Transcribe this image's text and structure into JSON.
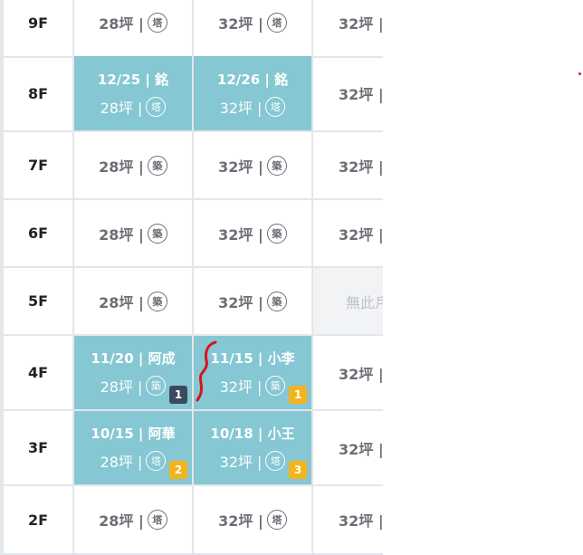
{
  "colors": {
    "booked_bg": "#85c7d3",
    "border": "#e3e6ea",
    "badge_dark": "#3c4a5e",
    "badge_yellow": "#f5b31c"
  },
  "rows": [
    {
      "floor": "9F",
      "units": [
        {
          "size": "28坪 |",
          "mark": "塔"
        },
        {
          "size": "32坪 |",
          "mark": "塔"
        },
        {
          "size": "32坪 |",
          "mark": ""
        }
      ]
    },
    {
      "floor": "8F",
      "units": [
        {
          "booking": "12/25 | 銘",
          "size": "28坪 |",
          "mark": "塔"
        },
        {
          "booking": "12/26 | 銘",
          "size": "32坪 |",
          "mark": "塔"
        },
        {
          "size": "32坪 |",
          "mark": ""
        }
      ]
    },
    {
      "floor": "7F",
      "units": [
        {
          "size": "28坪 |",
          "mark": "築"
        },
        {
          "size": "32坪 |",
          "mark": "築"
        },
        {
          "size": "32坪 |",
          "mark": ""
        }
      ]
    },
    {
      "floor": "6F",
      "units": [
        {
          "size": "28坪 |",
          "mark": "築"
        },
        {
          "size": "32坪 |",
          "mark": "築"
        },
        {
          "size": "32坪 |",
          "mark": ""
        }
      ]
    },
    {
      "floor": "5F",
      "units": [
        {
          "size": "28坪 |",
          "mark": "築"
        },
        {
          "size": "32坪 |",
          "mark": "築"
        },
        {
          "empty_text": "無此戶"
        }
      ]
    },
    {
      "floor": "4F",
      "units": [
        {
          "booking": "11/20 | 阿成",
          "size": "28坪 |",
          "mark": "築",
          "count": "1"
        },
        {
          "booking": "11/15 | 小李",
          "size": "32坪 |",
          "mark": "築",
          "count": "1"
        },
        {
          "size": "32坪 |",
          "mark": ""
        }
      ]
    },
    {
      "floor": "3F",
      "units": [
        {
          "booking": "10/15 | 阿華",
          "size": "28坪 |",
          "mark": "塔",
          "count": "2"
        },
        {
          "booking": "10/18 | 小王",
          "size": "32坪 |",
          "mark": "塔",
          "count": "3"
        },
        {
          "size": "32坪 |",
          "mark": ""
        }
      ]
    },
    {
      "floor": "2F",
      "units": [
        {
          "size": "28坪 |",
          "mark": "塔"
        },
        {
          "size": "32坪 |",
          "mark": "塔"
        },
        {
          "size": "32坪 |",
          "mark": ""
        }
      ]
    }
  ]
}
